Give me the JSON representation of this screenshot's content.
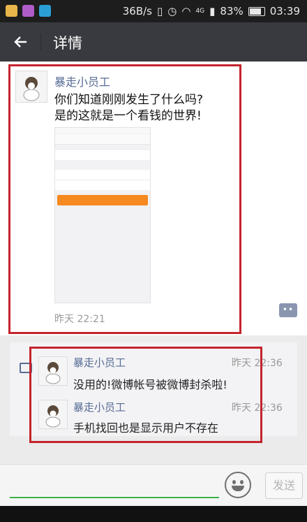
{
  "status_bar": {
    "speed": "36B/s",
    "network": "4G",
    "battery": "83%",
    "time": "03:39"
  },
  "toolbar": {
    "back_icon": "arrow-left-icon",
    "title": "详情"
  },
  "post": {
    "author": "暴走小员工",
    "text_line1": "你们知道刚刚发生了什么吗?",
    "text_line2": "是的这就是一个看钱的世界!",
    "time": "昨天 22:21"
  },
  "comments": [
    {
      "author": "暴走小员工",
      "time": "昨天 22:36",
      "text": "没用的!微博帐号被微博封杀啦!"
    },
    {
      "author": "暴走小员工",
      "time": "昨天 22:36",
      "text": "手机找回也是显示用户不存在"
    }
  ],
  "input_bar": {
    "send_label": "发送"
  },
  "colors": {
    "highlight": "#c4242d",
    "name": "#576b95",
    "button_orange": "#f6891f"
  }
}
